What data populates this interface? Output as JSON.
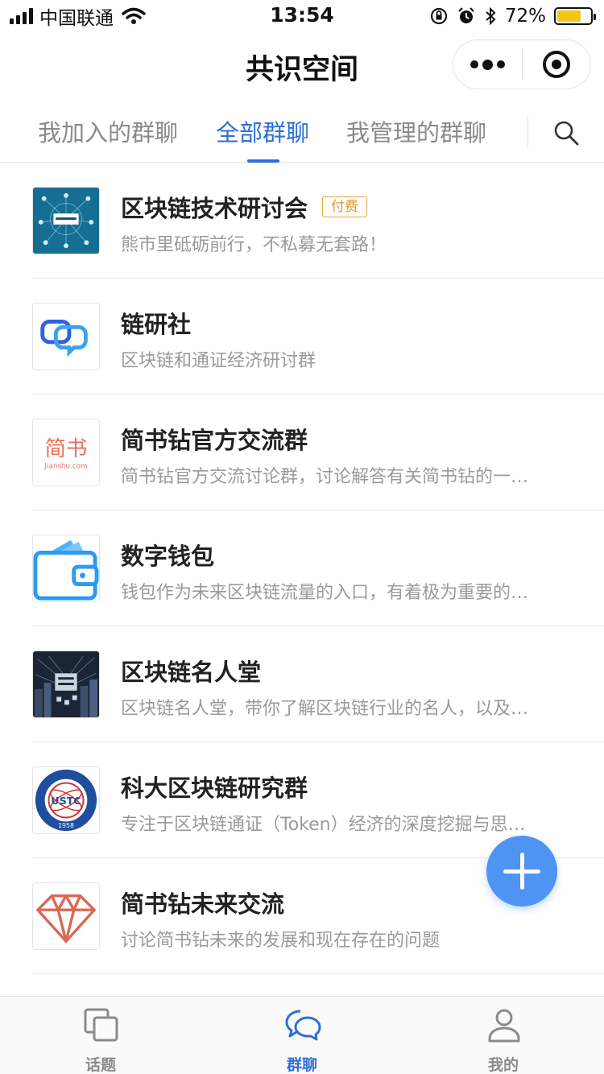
{
  "status_bar": {
    "carrier": "中国联通",
    "time": "13:54",
    "battery_percent": "72%",
    "battery_level": 0.72
  },
  "nav": {
    "title": "共识空间"
  },
  "tabs": [
    {
      "label": "我加入的群聊",
      "active": false
    },
    {
      "label": "全部群聊",
      "active": true
    },
    {
      "label": "我管理的群聊",
      "active": false
    }
  ],
  "groups": [
    {
      "name": "区块链技术研讨会",
      "badge": "付费",
      "desc": "熊市里砥砺前行，不私募无套路！",
      "avatar": "blockchain-network-image"
    },
    {
      "name": "链研社",
      "desc": "区块链和通证经济研讨群",
      "avatar": "chat-bubbles-logo"
    },
    {
      "name": "简书钻官方交流群",
      "desc": "简书钻官方交流讨论群，讨论解答有关简书钻的一…",
      "avatar": "jianshu-logo",
      "avatar_text": "简书",
      "avatar_subtext": "Jianshu.com"
    },
    {
      "name": "数字钱包",
      "desc": "钱包作为未来区块链流量的入口，有着极为重要的…",
      "avatar": "wallet-icon"
    },
    {
      "name": "区块链名人堂",
      "desc": "区块链名人堂，带你了解区块链行业的名人，以及…",
      "avatar": "blockchain-city-image"
    },
    {
      "name": "科大区块链研究群",
      "desc": "专注于区块链通证（Token）经济的深度挖掘与思…",
      "avatar": "ustc-seal",
      "avatar_text": "USTC",
      "avatar_year": "1958"
    },
    {
      "name": "简书钻未来交流",
      "desc": "讨论简书钻未来的发展和现在存在的问题",
      "avatar": "diamond-icon"
    }
  ],
  "tab_bar": [
    {
      "label": "话题",
      "icon": "topic-icon",
      "active": false
    },
    {
      "label": "群聊",
      "icon": "chat-icon",
      "active": true
    },
    {
      "label": "我的",
      "icon": "profile-icon",
      "active": false
    }
  ],
  "colors": {
    "accent": "#2f6fd6",
    "fab": "#4f93f3",
    "badge": "#e0962a",
    "battery": "#f5c518"
  }
}
